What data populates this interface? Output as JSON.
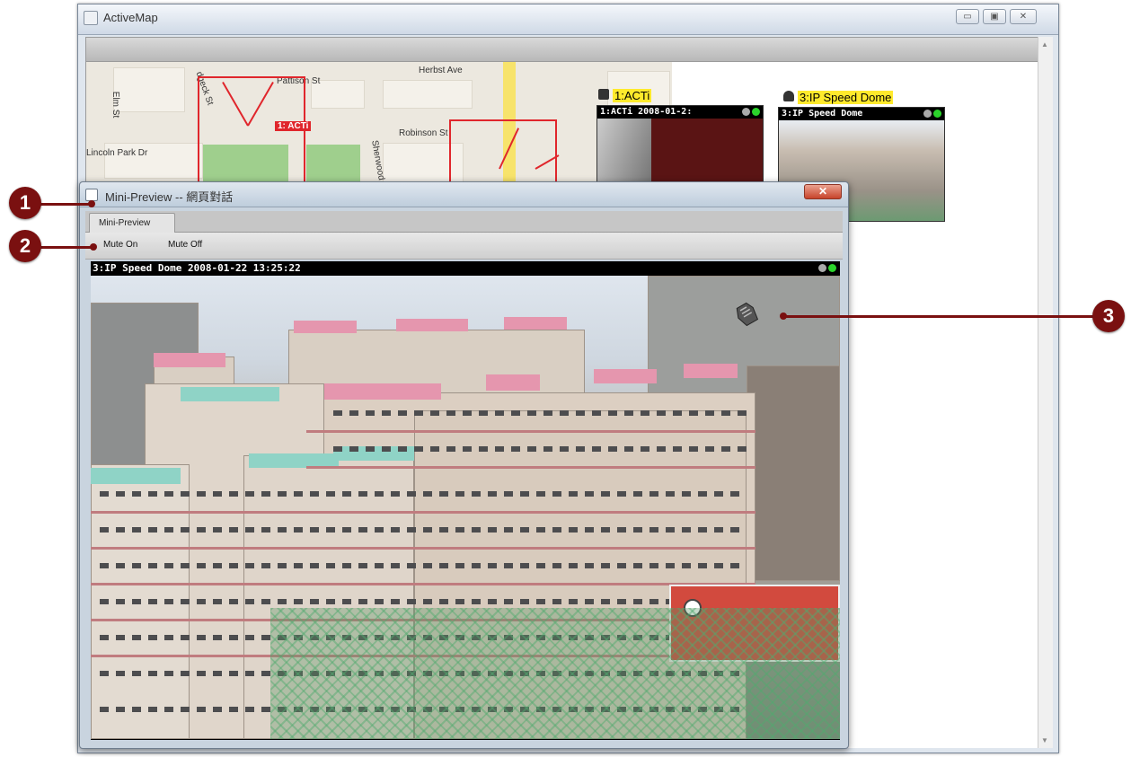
{
  "app_window": {
    "title": "ActiveMap",
    "controls": {
      "minimize": "▭",
      "maximize": "▣",
      "close": "✕"
    }
  },
  "map": {
    "streets": [
      "Herbst Ave",
      "Pattison St",
      "Robinson St",
      "Lincoln Park Dr",
      "Elm St",
      "Sherwood",
      "dgeck St"
    ],
    "camera_badge": "1: ACTi"
  },
  "thumbnails": [
    {
      "label": "1:ACTi",
      "overlay": "1:ACTi  2008-01-2:",
      "icon": "box-camera-icon"
    },
    {
      "label": "3:IP Speed Dome",
      "overlay": "3:IP Speed Dome",
      "icon": "dome-camera-icon"
    }
  ],
  "mini_preview": {
    "title": "Mini-Preview -- 網頁對話",
    "close": "✕",
    "tab": "Mini-Preview",
    "menu": [
      "Mute On",
      "Mute Off"
    ],
    "video_overlay": "3:IP Speed Dome   2008-01-22 13:25:22"
  },
  "callouts": [
    "1",
    "2",
    "3"
  ],
  "colors": {
    "highlight": "#ffea2c",
    "camera_red": "#e0262c",
    "callout": "#7a1010"
  }
}
